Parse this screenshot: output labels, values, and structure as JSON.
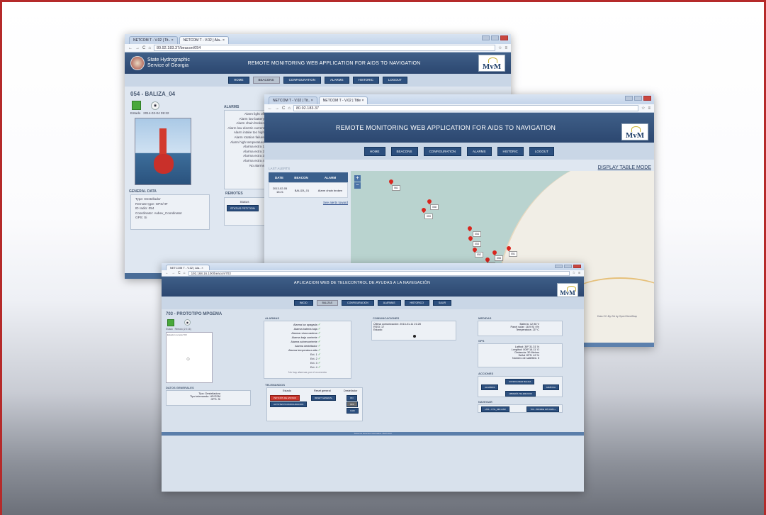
{
  "back": {
    "tabs": [
      "NETCOM T - V.02 | Tit.. ×",
      "NETCOM T - V.02 | Ala.. ×"
    ],
    "url": "80.92.183.37/beacon/054",
    "org_line1": "State Hydrographic",
    "org_line2": "Service of Georgia",
    "app_title": "REMOTE MONITORING WEB APPLICATION FOR AIDS TO NAVIGATION",
    "logo": "MvM",
    "nav": [
      "HOME",
      "BEACONS",
      "CONFIGURATION",
      "ALARMS",
      "HISTORIC",
      "LOGOUT"
    ],
    "beacon_title": "054 - BALIZA_04",
    "status_date": "2014-02-04 09:22",
    "status_label": "Estado",
    "alarms_header": "ALARMS",
    "alarms": [
      "Alarm light off",
      "Alarm low battery",
      "Alarm chain broken",
      "Alarm low electric current",
      "Alarm intake too high",
      "Alarm rotation failure",
      "Alarm high temperature",
      "Alarma extra 1",
      "Alarma extra 2",
      "Alarma extra 3",
      "Alarma extra 4",
      "No alarms"
    ],
    "general_header": "GENERAL DATA",
    "general": [
      [
        "Type:",
        "Destellador"
      ],
      [
        "Remote type:",
        "GPS/HF"
      ],
      [
        "ID radio:",
        "054"
      ],
      [
        "Coordinator:",
        "Aubev_Coordinator"
      ],
      [
        "GPS:",
        "Si"
      ]
    ],
    "remotes_header": "REMOTES",
    "remotes_status": "Status",
    "remotes_btn": "STATUS PETITION"
  },
  "mid": {
    "tabs": [
      "NETCOM T - V.02 | Tit.. ×",
      "NETCOM T - V.02 | Title ×"
    ],
    "url": "80.92.183.37",
    "app_title": "REMOTE MONITORING WEB APPLICATION FOR AIDS TO NAVIGATION",
    "logo": "MvM",
    "nav": [
      "HOME",
      "BEACONS",
      "CONFIGURATION",
      "ALARMS",
      "HISTORIC",
      "LOGOUT"
    ],
    "display_mode": "DISPLAY TABLE MODE",
    "last_alerts": "LAST ALERTS",
    "cols": [
      "DATE",
      "BEACON",
      "ALARM"
    ],
    "row": [
      "2013-02-05 15:21",
      "BALIZA_01",
      "Alarm chain broken"
    ],
    "see_all": "See alerts toward",
    "zoom_in": "+",
    "zoom_out": "−",
    "pins": [
      "061",
      "058",
      "059",
      "054",
      "053",
      "052",
      "055",
      "051",
      "051"
    ],
    "attribution": "Data CC-By-SA by OpenStreetMap"
  },
  "front": {
    "tabs": [
      "NETCOM T - V.02 | Ala.. ×"
    ],
    "url": "192.168.16.100/beacon/703",
    "app_title": "APLICACION WEB DE TELECONTROL DE AYUDAS A LA NAVEGACIÓN",
    "logo": "MvM",
    "nav": [
      "INICIO",
      "BALIZAS",
      "CONFIGURACION",
      "ALARMAS",
      "HISTORICO",
      "SALIR"
    ],
    "beacon_title": "703 - PROTOTIPO MPGEMA",
    "status_label": "Estado",
    "remote_label": "Remoto (2 0:16)",
    "image_caption": "Estación remota 703",
    "alarms_header": "ALARMAS",
    "alarms": [
      "Alarma luz apagada",
      "Alarma batería baja",
      "Alarma rotura cadena",
      "Alarma baja corriente",
      "Alarma sobrecorriente",
      "Alarma destellador",
      "Alarma temperatura alta",
      "Ext. 1",
      "Ext. 2",
      "Ext. 3",
      "Ext. 4"
    ],
    "no_alarms": "No hay alarmas por el momento",
    "comm_header": "COMUNICACIONES",
    "comm": [
      [
        "Última comunicación:",
        "2013-01-11 21:28"
      ],
      [
        "RSSI:",
        "17"
      ],
      [
        "Estado:",
        ""
      ]
    ],
    "measures_header": "MEDIDAS",
    "measures": [
      [
        "Batería:",
        "12,98 V"
      ],
      [
        "Panel solar:",
        "18,9 W, 0%"
      ],
      [
        "Temperatura:",
        "21º C"
      ]
    ],
    "gps_header": "GPS",
    "gps": [
      [
        "Latitud:",
        "36º 31.31' N"
      ],
      [
        "Longitud:",
        "006º 16.11' O"
      ],
      [
        "Distancia:",
        "30 Metros"
      ],
      [
        "Señal GPS:",
        "42 %"
      ],
      [
        "Número de satélites:",
        "5"
      ]
    ],
    "general_header": "DATOS GENERALES",
    "general": [
      [
        "Tipo:",
        "Destelladora"
      ],
      [
        "Tipo telemando:",
        "HF/GSM"
      ],
      [
        "GPS:",
        "Si"
      ]
    ],
    "telemand_header": "TELEMANDOS",
    "tm_cols": [
      "Estado",
      "Reset general",
      "Destellador"
    ],
    "tm_btn1": "PETICIÓN DE ESTADO",
    "tm_btn2": "AUTOTEST/CONFIGURACION",
    "tm_btn3": "RESET GENERAL",
    "tm_small": [
      "ON",
      "OFF",
      "CAM"
    ],
    "actions_header": "ACCIONES",
    "actions": [
      "CONFIGURAR BALIZA",
      "ALARMAS",
      "GRÁFICA",
      "LIBRERÍA TELEMANDO"
    ],
    "nav_header": "NAVEGAR",
    "nav_btns": [
      "«701 - FTG_MIK1 #02",
      "703 - PROMIE 105 GSM »"
    ],
    "footer": "Todos los derechos reservados. MvM 2013"
  }
}
